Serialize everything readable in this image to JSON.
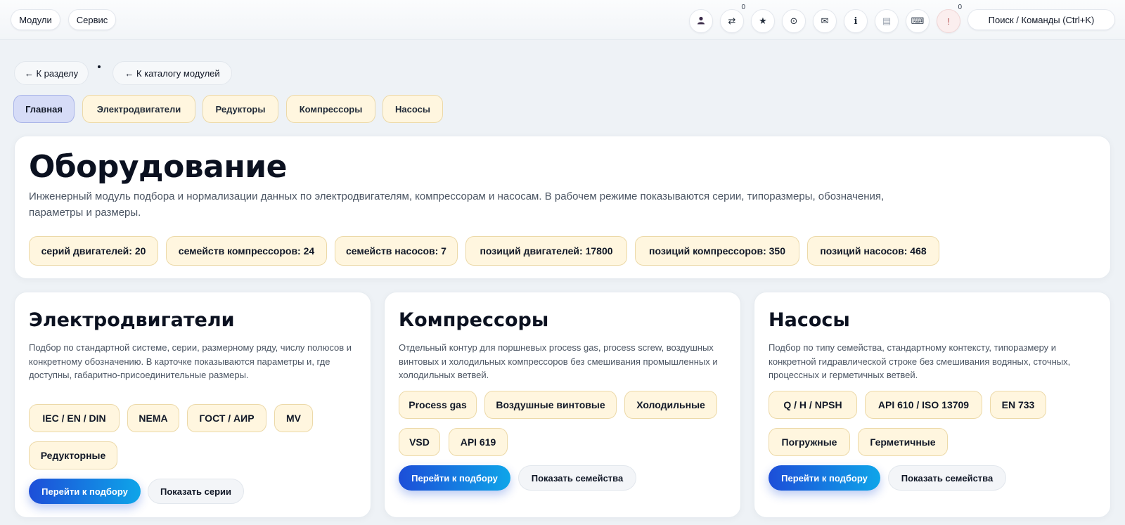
{
  "topbar": {
    "left_menu": [
      {
        "label": "Модули"
      },
      {
        "label": "Сервис"
      }
    ],
    "icons": [
      {
        "icon": "user-icon",
        "glyph": "👤"
      },
      {
        "icon": "compare-icon",
        "glyph": "⇄",
        "badge": "0"
      },
      {
        "icon": "star-icon",
        "glyph": "★"
      },
      {
        "icon": "history-icon",
        "glyph": "⊙"
      },
      {
        "icon": "mail-icon",
        "glyph": "✉"
      },
      {
        "icon": "info-icon",
        "glyph": "i"
      },
      {
        "icon": "document-icon",
        "glyph": "▤"
      },
      {
        "icon": "keyboard-icon",
        "glyph": "⌨"
      },
      {
        "icon": "alert-icon",
        "glyph": "!",
        "badge": "0"
      }
    ],
    "search_label": "Поиск / Команды (Ctrl+K)"
  },
  "nav": {
    "back_section": "← К разделу",
    "back_catalog": "← К каталогу модулей"
  },
  "tabs": [
    {
      "label": "Главная",
      "active": true
    },
    {
      "label": "Электродвигатели"
    },
    {
      "label": "Редукторы"
    },
    {
      "label": "Компрессоры"
    },
    {
      "label": "Насосы"
    }
  ],
  "hero": {
    "title": "Оборудование",
    "description": "Инженерный модуль подбора и нормализации данных по электродвигателям, компрессорам и насосам. В рабочем режиме показываются серии, типоразмеры, обозначения, параметры и размеры.",
    "stats": [
      "серий двигателей: 20",
      "семейств компрессоров: 24",
      "семейств насосов: 7",
      "позиций двигателей: 17800",
      "позиций компрессоров: 350",
      "позиций насосов: 468"
    ]
  },
  "modules": [
    {
      "title": "Электродвигатели",
      "description": "Подбор по стандартной системе, серии, размерному ряду, числу полюсов и конкретному обозначению. В карточке показываются параметры и, где доступны, габаритно-присоединительные размеры.",
      "chips": [
        "IEC / EN / DIN",
        "NEMA",
        "ГОСТ / АИР",
        "MV",
        "Редукторные"
      ],
      "primary": "Перейти к подбору",
      "secondary": "Показать серии"
    },
    {
      "title": "Компрессоры",
      "description": "Отдельный контур для поршневых process gas, process screw, воздушных винтовых и холодильных компрессоров без смешивания промышленных и холодильных ветвей.",
      "chips": [
        "Process gas",
        "Воздушные винтовые",
        "Холодильные",
        "VSD",
        "API 619"
      ],
      "primary": "Перейти к подбору",
      "secondary": "Показать семейства"
    },
    {
      "title": "Насосы",
      "description": "Подбор по типу семейства, стандартному контексту, типоразмеру и конкретной гидравлической строке без смешивания водяных, сточных, процессных и герметичных ветвей.",
      "chips": [
        "Q / H / NPSH",
        "API 610 / ISO 13709",
        "EN 733",
        "Погружные",
        "Герметичные"
      ],
      "primary": "Перейти к подбору",
      "secondary": "Показать семейства"
    }
  ]
}
